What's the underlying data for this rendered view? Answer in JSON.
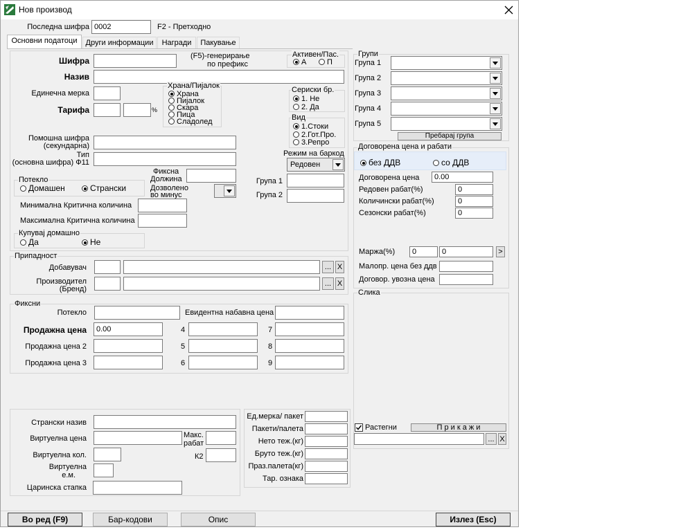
{
  "window": {
    "title": "Нов производ"
  },
  "top": {
    "last_code_label": "Последна шифра",
    "last_code_value": "0002",
    "prev_hint": "F2 - Претходно"
  },
  "tabs": [
    "Основни податоци",
    "Други информации",
    "Награди",
    "Пакување"
  ],
  "basic": {
    "code_label": "Шифра",
    "prefix_line1": "(F5)-генерирање",
    "prefix_line2": "по префикс",
    "name_label": "Назив",
    "unit_label": "Единечна мерка",
    "tariff_label": "Тарифа",
    "percent": "%",
    "active": {
      "title": "Активен/Пас.",
      "opt_a": "А",
      "opt_p": "П"
    },
    "food": {
      "title": "Храна/Пијалок",
      "options": [
        "Храна",
        "Пијалок",
        "Скара",
        "Пица",
        "Сладолед"
      ]
    },
    "serial": {
      "title": "Сериски бр.",
      "options": [
        "1. Не",
        "2. Да"
      ]
    },
    "kind": {
      "title": "Вид",
      "options": [
        "1.Стоки",
        "2.Гот.Про.",
        "3.Репро"
      ]
    },
    "barcode_mode": {
      "label": "Режим на баркод",
      "value": "Редовен"
    },
    "aux_label_1": "Помошна шифра",
    "aux_label_2": "(секундарна)",
    "type_label_1": "Тип",
    "type_label_2": "(основна шифра) Ф11",
    "origin": {
      "title": "Потекло",
      "domestic": "Домашен",
      "foreign": "Странски"
    },
    "fixed_length_1": "Фиксна",
    "fixed_length_2": "Должина",
    "allowed_minus_1": "Дозволено",
    "allowed_minus_2": "во минус",
    "group1_label": "Група 1",
    "group2_label": "Група 2",
    "min_qty_label": "Минимална Критична количина",
    "max_qty_label": "Максимална Критична количина",
    "buy_domestic": {
      "title": "Купувај домашно",
      "yes": "Да",
      "no": "Не"
    }
  },
  "belonging": {
    "title": "Припадност",
    "supplier_label": "Добавувач",
    "producer_label_1": "Производител",
    "producer_label_2": "(Бренд)",
    "dots": "...",
    "x": "X"
  },
  "fixed": {
    "title": "Фиксни",
    "origin_label": "Потекло",
    "record_price_label": "Евидентна набавна цена",
    "sale_price_label": "Продажна цена",
    "sale_price_value": "0.00",
    "sale_price2_label": "Продажна цена 2",
    "sale_price3_label": "Продажна цена 3",
    "n4": "4",
    "n5": "5",
    "n6": "6",
    "n7": "7",
    "n8": "8",
    "n9": "9"
  },
  "bottom": {
    "foreign_name": "Странски назив",
    "virtual_price": "Виртуелна цена",
    "max_discount_1": "Макс.",
    "max_discount_2": "рабат",
    "virtual_qty": "Виртуелна кол.",
    "k2": "К2",
    "virtual_unit_1": "Виртуелна",
    "virtual_unit_2": "е.м.",
    "customs_rate": "Царинска стапка"
  },
  "packaging": {
    "unit_per_pack": "Ед.мерка/ пакет",
    "packs_per_pallet": "Пакети/палета",
    "net_weight": "Нето теж.(кг)",
    "gross_weight": "Бруто теж.(кг)",
    "empty_pallet": "Праз.палета(кг)",
    "tariff_mark": "Тар. ознака"
  },
  "groups": {
    "title": "Групи",
    "labels": [
      "Група 1",
      "Група 2",
      "Група 3",
      "Група 4",
      "Група 5"
    ],
    "search_btn": "Пребарај група"
  },
  "price": {
    "title": "Договорена цена и рабати",
    "without_vat": "без ДДВ",
    "with_vat": "со ДДВ",
    "agreed_price": "Договорена цена",
    "agreed_price_value": "0.00",
    "regular_discount": "Редовен рабат(%)",
    "regular_discount_value": "0",
    "quantity_discount": "Количински рабат(%)",
    "quantity_discount_value": "0",
    "seasonal_discount": "Сезонски рабат(%)",
    "seasonal_discount_value": "0",
    "margin": "Маржа(%)",
    "margin_value1": "0",
    "margin_value2": "0",
    "arrow": ">",
    "retail_price": "Малопр. цена без ддв",
    "import_price": "Договор. увозна цена"
  },
  "image": {
    "title": "Слика",
    "stretch": "Растегни",
    "show_btn": "П р и к а ж и",
    "dots": "...",
    "x": "X"
  },
  "footer": {
    "next": "Во ред (F9)",
    "barcodes": "Бар-кодови",
    "description": "Опис",
    "exit": "Излез (Esc)"
  }
}
